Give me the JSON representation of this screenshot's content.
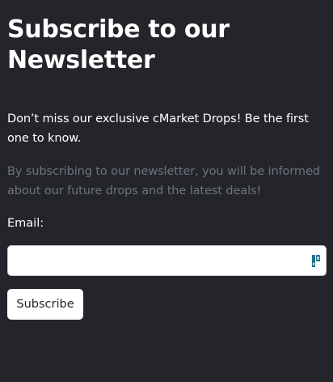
{
  "newsletter": {
    "title_line1": "Subscribe to our",
    "title_line2": "Newsletter",
    "lead": "Don’t miss our exclusive cMarket Drops! Be the first one to know.",
    "description": "By subscribing to our newsletter, you will be informed about our future drops and the latest deals!",
    "email_label": "Email:",
    "email_value": "",
    "email_icon": "password-manager-icon",
    "subscribe_label": "Subscribe"
  },
  "colors": {
    "background": "#24252b",
    "muted_text": "#6e747c",
    "icon_accent": "#1f6f8b"
  }
}
